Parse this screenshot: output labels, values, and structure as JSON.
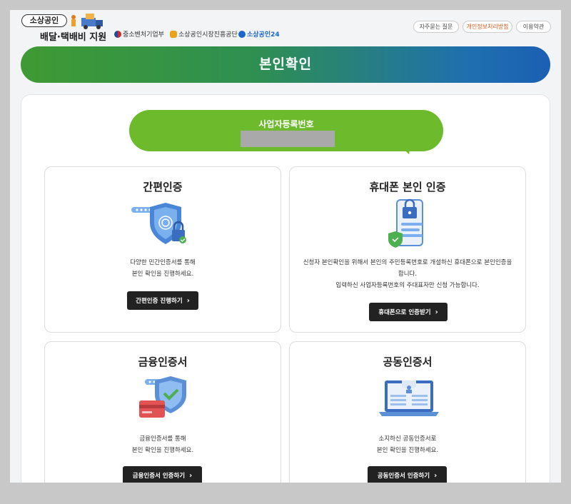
{
  "header": {
    "logo_pill": "소상공인",
    "logo_sub": "배달·택배비 지원",
    "partners": [
      {
        "label": "중소벤처기업부",
        "icon": "korea-emblem-icon",
        "color": "#1d4e9a"
      },
      {
        "label": "소상공인시장진흥공단",
        "icon": "semas-icon",
        "color": "#e8a21c"
      },
      {
        "label": "소상공인24",
        "icon": "sbiz24-icon",
        "color": "#1a67c8"
      }
    ],
    "links": [
      {
        "label": "자주묻는 질문"
      },
      {
        "label": "개인정보처리방침",
        "color": "#e05a1c"
      },
      {
        "label": "이용약관"
      }
    ]
  },
  "banner": {
    "title": "본인확인"
  },
  "business_number": {
    "label": "사업자등록번호"
  },
  "cards": [
    {
      "title": "간편인증",
      "desc": [
        "다양한 민간인증서를 통해",
        "본인 확인을 진행하세요."
      ],
      "button": "간편인증 진행하기",
      "icon": "fingerprint-shield-lock-icon"
    },
    {
      "title": "휴대폰 본인 인증",
      "desc": [
        "신청자 본인확인을 위해서 본인의 주민등록번호로 개설하신 휴대폰으로 본인인증을",
        "합니다.",
        "입력하신 사업자등록번호의 주대표자만 신청 가능합니다."
      ],
      "button": "휴대폰으로 인증받기",
      "icon": "phone-lock-icon"
    },
    {
      "title": "금융인증서",
      "desc": [
        "금융인증서를 통해",
        "본인 확인을 진행하세요."
      ],
      "button": "금융인증서 인증하기",
      "icon": "shield-card-icon"
    },
    {
      "title": "공동인증서",
      "desc": [
        "소지하신 공동인증서로",
        "본인 확인을 진행하세요."
      ],
      "button": "공동인증서 인증하기",
      "icon": "laptop-certificate-icon"
    }
  ],
  "colors": {
    "green": "#6dbb2c",
    "banner_start": "#3f9a33",
    "banner_end": "#1b5fb2",
    "button": "#222222"
  }
}
